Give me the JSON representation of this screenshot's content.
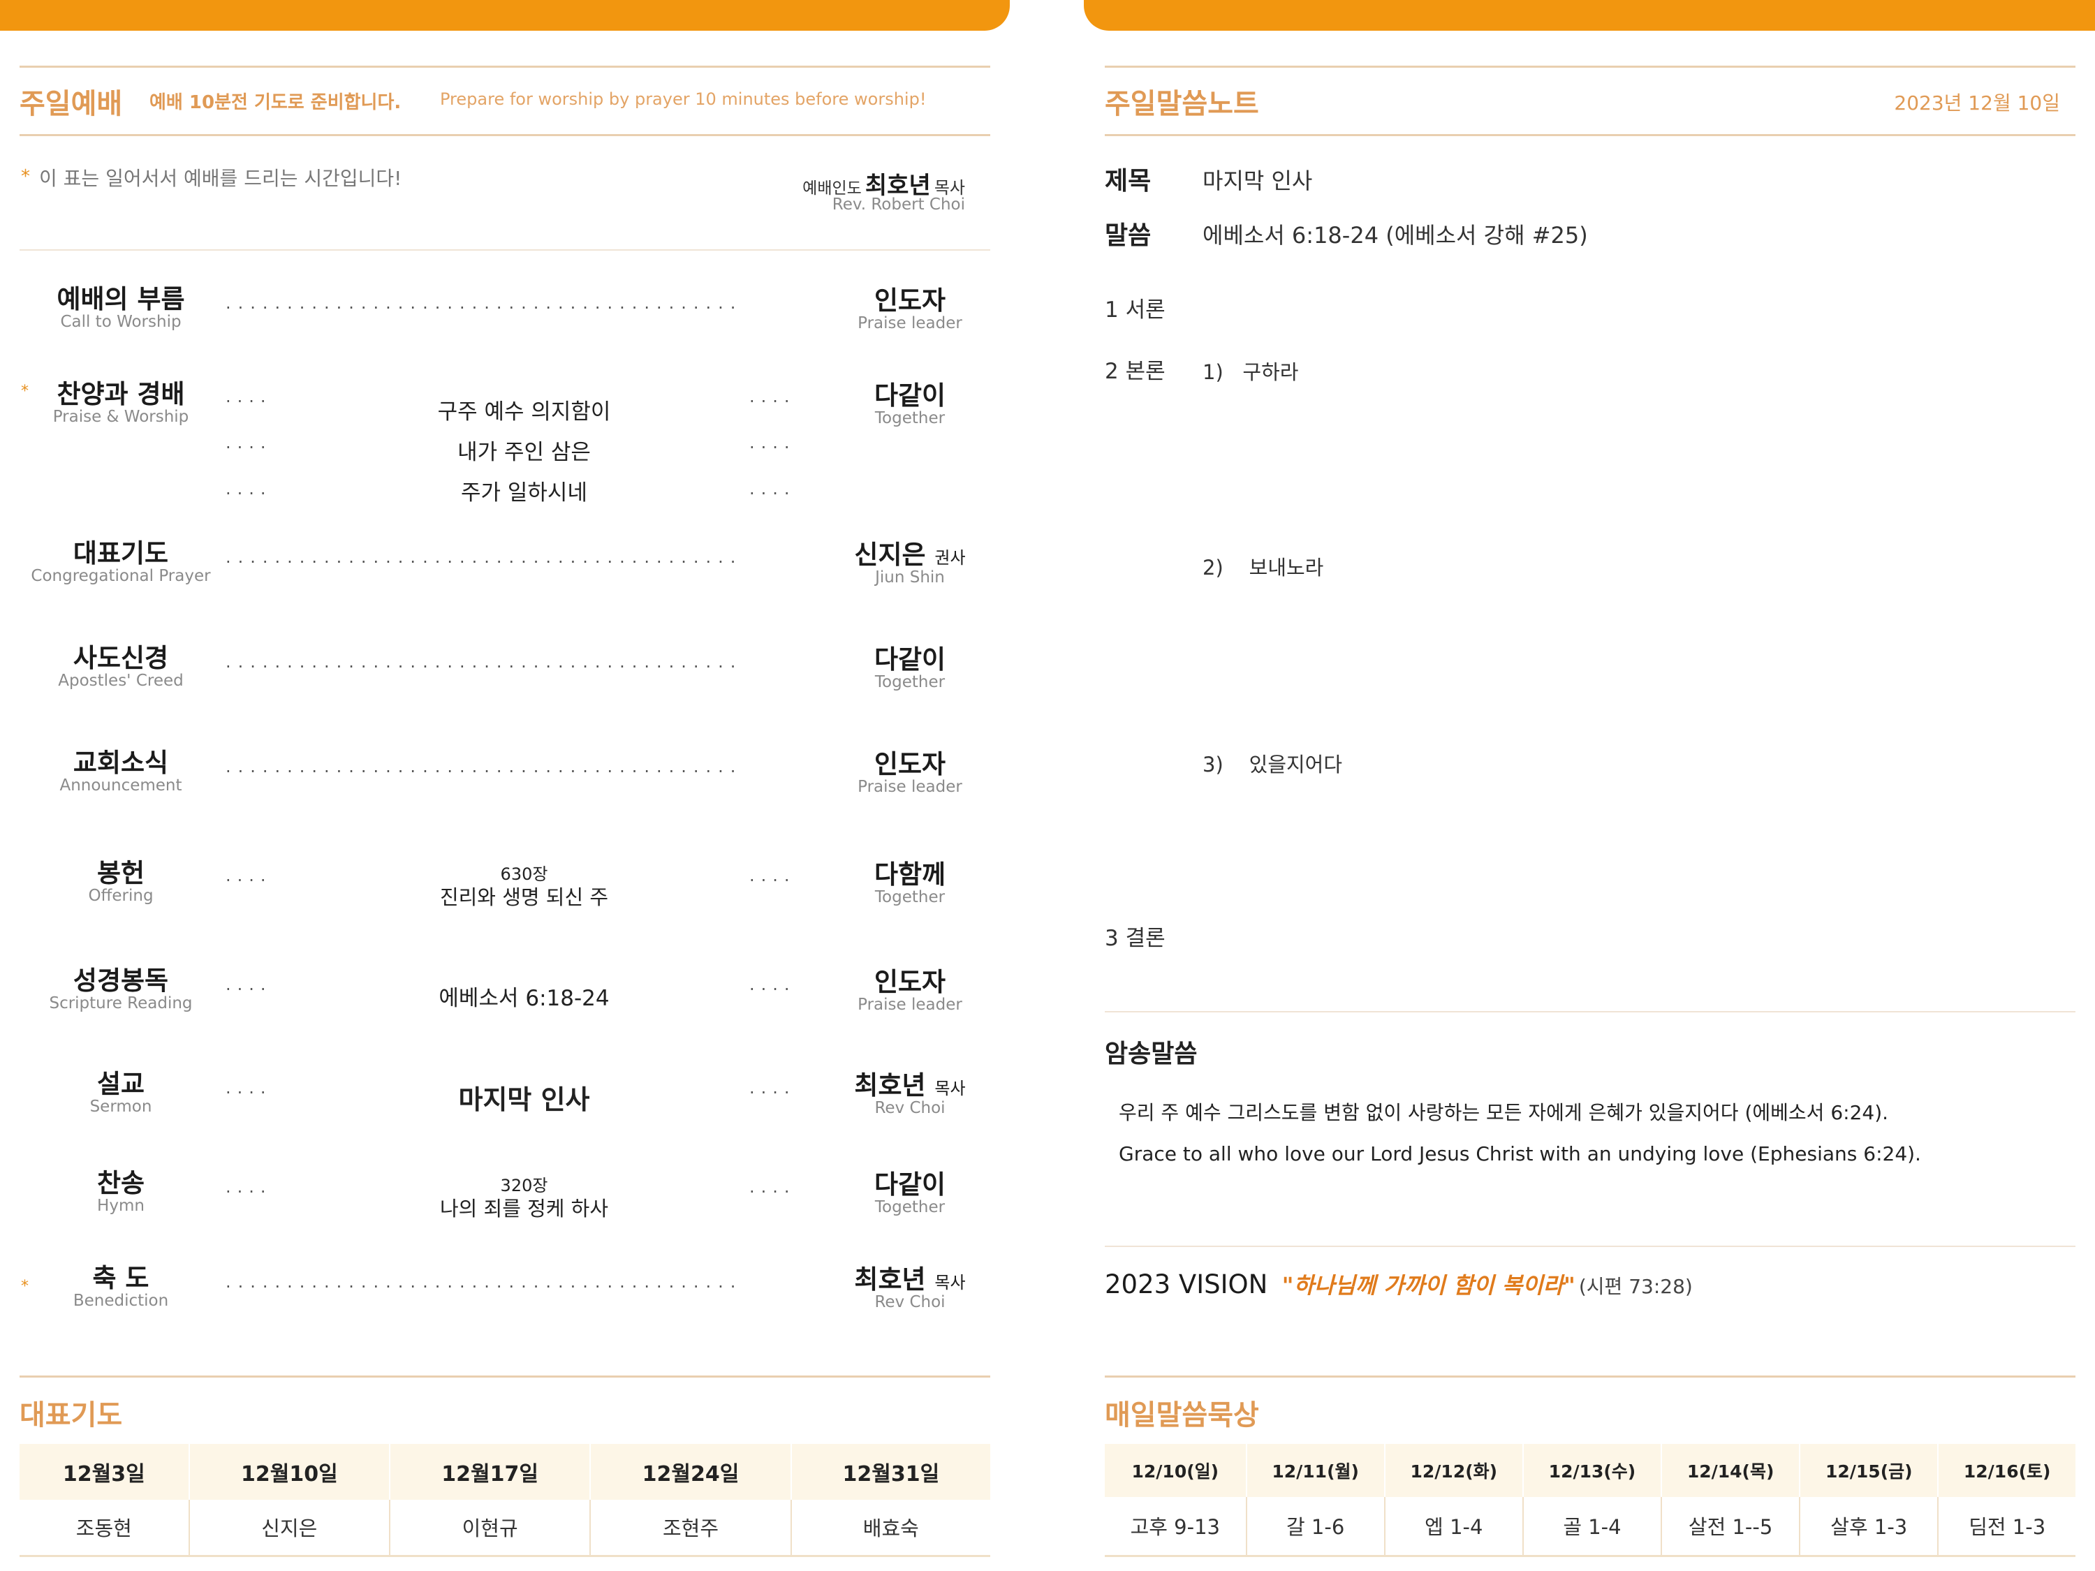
{
  "left": {
    "worship": {
      "title": "주일예배",
      "subtitle_ko": "예배 10분전 기도로 준비합니다.",
      "subtitle_en": "Prepare for worship by prayer 10 minutes before worship!",
      "note": "이 표는 일어서서 예배를 드리는 시간입니다!",
      "note_star": "*",
      "leader_role": "예배인도",
      "leader_name": "최호년",
      "leader_title": "목사",
      "leader_en": "Rev. Robert Choi"
    },
    "service": [
      {
        "ko": "예배의 부름",
        "en": "Call to Worship",
        "lead": "인도자",
        "lead_en": "Praise leader"
      },
      {
        "ko": "찬양과 경배",
        "en": "Praise & Worship",
        "lead": "다같이",
        "lead_en": "Together",
        "star": "*",
        "songs": [
          "구주 예수 의지함이",
          "내가 주인 삼은",
          "주가 일하시네"
        ]
      },
      {
        "ko": "대표기도",
        "en": "Congregational Prayer",
        "lead": "신지은",
        "lead_title": "권사",
        "lead_en": "Jiun Shin"
      },
      {
        "ko": "사도신경",
        "en": "Apostles' Creed",
        "lead": "다같이",
        "lead_en": "Together"
      },
      {
        "ko": "교회소식",
        "en": "Announcement",
        "lead": "인도자",
        "lead_en": "Praise leader"
      },
      {
        "ko": "봉헌",
        "en": "Offering",
        "lead": "다함께",
        "lead_en": "Together",
        "hymn_no": "630장",
        "hymn": "진리와 생명 되신 주"
      },
      {
        "ko": "성경봉독",
        "en": "Scripture Reading",
        "lead": "인도자",
        "lead_en": "Praise leader",
        "text": "에베소서 6:18-24"
      },
      {
        "ko": "설교",
        "en": "Sermon",
        "lead": "최호년",
        "lead_title": "목사",
        "lead_en": "Rev Choi",
        "text": "마지막 인사"
      },
      {
        "ko": "찬송",
        "en": "Hymn",
        "lead": "다같이",
        "lead_en": "Together",
        "hymn_no": "320장",
        "hymn": "나의 죄를 정케 하사"
      },
      {
        "ko": "축 도",
        "en": "Benediction",
        "lead": "최호년",
        "lead_title": "목사",
        "lead_en": "Rev Choi",
        "star": "*"
      }
    ],
    "dots_long": "..........................................",
    "dots_short": "....",
    "prayer": {
      "title": "대표기도",
      "dates": [
        "12월3일",
        "12월10일",
        "12월17일",
        "12월24일",
        "12월31일"
      ],
      "names": [
        "조동현",
        "신지은",
        "이현규",
        "조현주",
        "배효숙"
      ]
    }
  },
  "right": {
    "notes": {
      "title": "주일말씀노트",
      "date": "2023년 12월 10일",
      "subject_label": "제목",
      "subject": "마지막 인사",
      "scripture_label": "말씀",
      "scripture": "에베소서 6:18-24 (에베소서 강해 #25)",
      "intro": "1 서론",
      "body": "2 본론",
      "points": [
        {
          "no": "1)",
          "text": "구하라"
        },
        {
          "no": "2)",
          "text": "보내노라"
        },
        {
          "no": "3)",
          "text": "있을지어다"
        }
      ],
      "conclusion": "3 결론"
    },
    "memory": {
      "title": "암송말씀",
      "ko": "우리 주 예수 그리스도를 변함 없이 사랑하는 모든 자에게 은혜가 있을지어다  (에베소서 6:24).",
      "en": "Grace to all who love our Lord Jesus Christ with an undying love  (Ephesians 6:24)."
    },
    "vision": {
      "label": "2023 VISION",
      "quote": "\"하나님께 가까이 함이 복이라\"",
      "ref": "(시편 73:28)"
    },
    "daily": {
      "title": "매일말씀묵상",
      "dates": [
        "12/10(일)",
        "12/11(월)",
        "12/12(화)",
        "12/13(수)",
        "12/14(목)",
        "12/15(금)",
        "12/16(토)"
      ],
      "readings": [
        "고후 9-13",
        "갈 1-6",
        "엡 1-4",
        "골 1-4",
        "살전 1--5",
        "살후 1-3",
        "딤전 1-3"
      ]
    }
  },
  "colors": {
    "accent": "#f2960f",
    "heading": "#e09a55",
    "vision_quote": "#e07b1c"
  }
}
